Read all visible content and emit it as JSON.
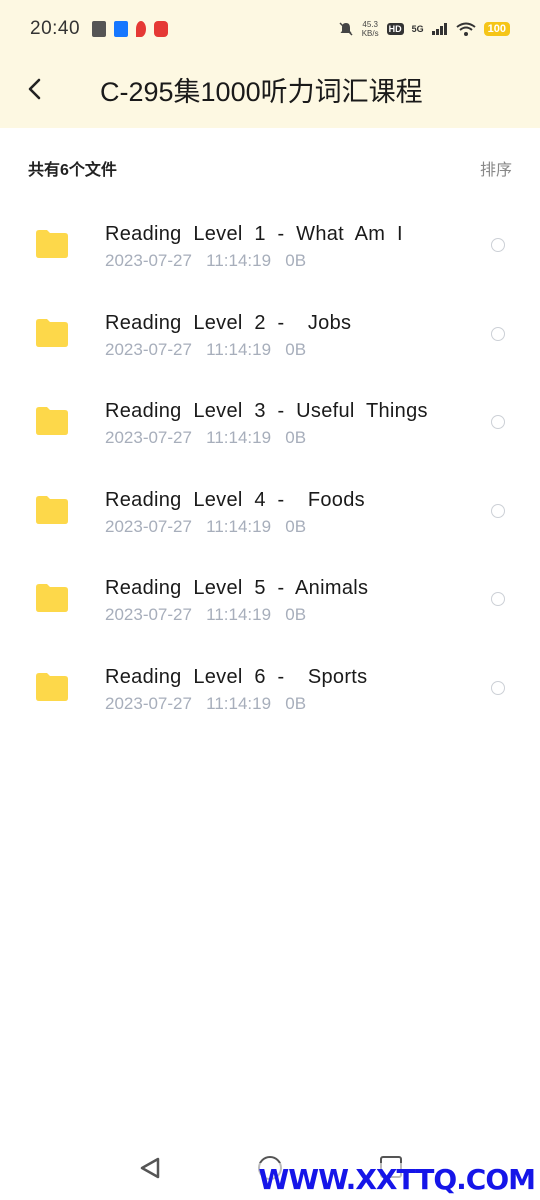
{
  "status_bar": {
    "time": "20:40",
    "net_speed_value": "45.3",
    "net_speed_unit": "KB/s",
    "hd_label": "HD",
    "signal_label": "5G",
    "battery": "100"
  },
  "header": {
    "title": "C-295集1000听力词汇课程"
  },
  "toolbar": {
    "count_label": "共有6个文件",
    "sort_label": "排序"
  },
  "files": [
    {
      "name": "Reading  Level  1  -  What  Am  I",
      "date": "2023-07-27",
      "time": "11:14:19",
      "size": "0B"
    },
    {
      "name": "Reading  Level  2  -    Jobs",
      "date": "2023-07-27",
      "time": "11:14:19",
      "size": "0B"
    },
    {
      "name": "Reading  Level  3  -  Useful  Things",
      "date": "2023-07-27",
      "time": "11:14:19",
      "size": "0B"
    },
    {
      "name": "Reading  Level  4  -    Foods",
      "date": "2023-07-27",
      "time": "11:14:19",
      "size": "0B"
    },
    {
      "name": "Reading  Level  5  -  Animals",
      "date": "2023-07-27",
      "time": "11:14:19",
      "size": "0B"
    },
    {
      "name": "Reading  Level  6  -    Sports",
      "date": "2023-07-27",
      "time": "11:14:19",
      "size": "0B"
    }
  ],
  "watermark": "WWW.XXTTQ.COM",
  "colors": {
    "header_bg": "#fdf8e2",
    "folder": "#fdd84a",
    "meta_text": "#a7aebb",
    "watermark": "#1515e8"
  },
  "icons": {
    "back": "chevron-left-icon",
    "folder": "folder-icon",
    "radio": "radio-unchecked-icon"
  }
}
